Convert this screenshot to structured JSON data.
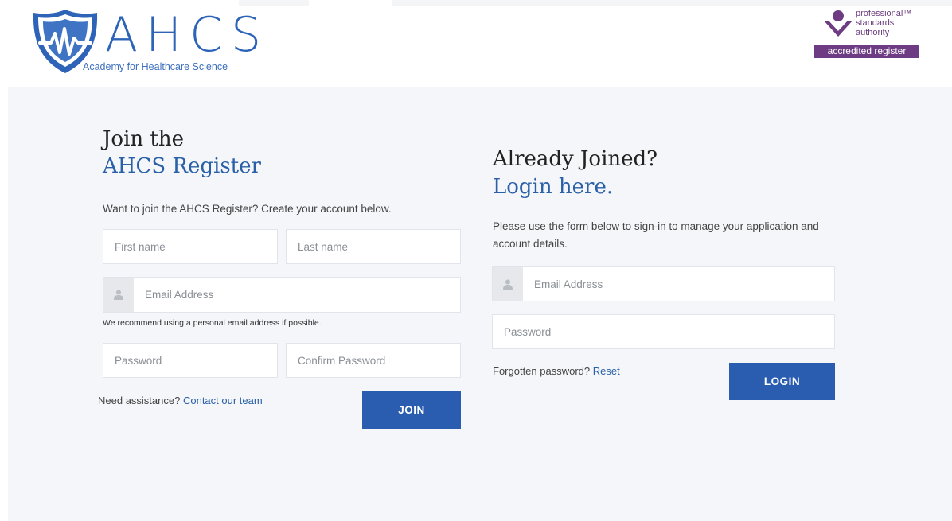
{
  "brand": {
    "logo_text": "AHCS",
    "logo_subtitle": "Academy for Healthcare Science",
    "color_primary": "#2a5db0"
  },
  "accreditation": {
    "line1": "professional™",
    "line2": "standards",
    "line3": "authority",
    "badge": "accredited register",
    "color": "#6d3c82"
  },
  "join": {
    "heading_line1": "Join the",
    "heading_line2": "AHCS Register",
    "intro": "Want to join the AHCS Register? Create your account below.",
    "first_name_placeholder": "First name",
    "last_name_placeholder": "Last name",
    "email_placeholder": "Email Address",
    "email_icon": "user-icon",
    "email_hint": "We recommend using a personal email address if possible.",
    "password_placeholder": "Password",
    "confirm_password_placeholder": "Confirm Password",
    "assistance_text": "Need assistance?",
    "assistance_link": "Contact our team",
    "button_label": "JOIN"
  },
  "login": {
    "heading_line1": "Already Joined?",
    "heading_line2": "Login here.",
    "intro": "Please use the form below to sign-in to manage your application and account details.",
    "email_placeholder": "Email Address",
    "email_icon": "user-icon",
    "password_placeholder": "Password",
    "forgot_text": "Forgotten password?",
    "reset_link": "Reset",
    "button_label": "LOGIN"
  }
}
